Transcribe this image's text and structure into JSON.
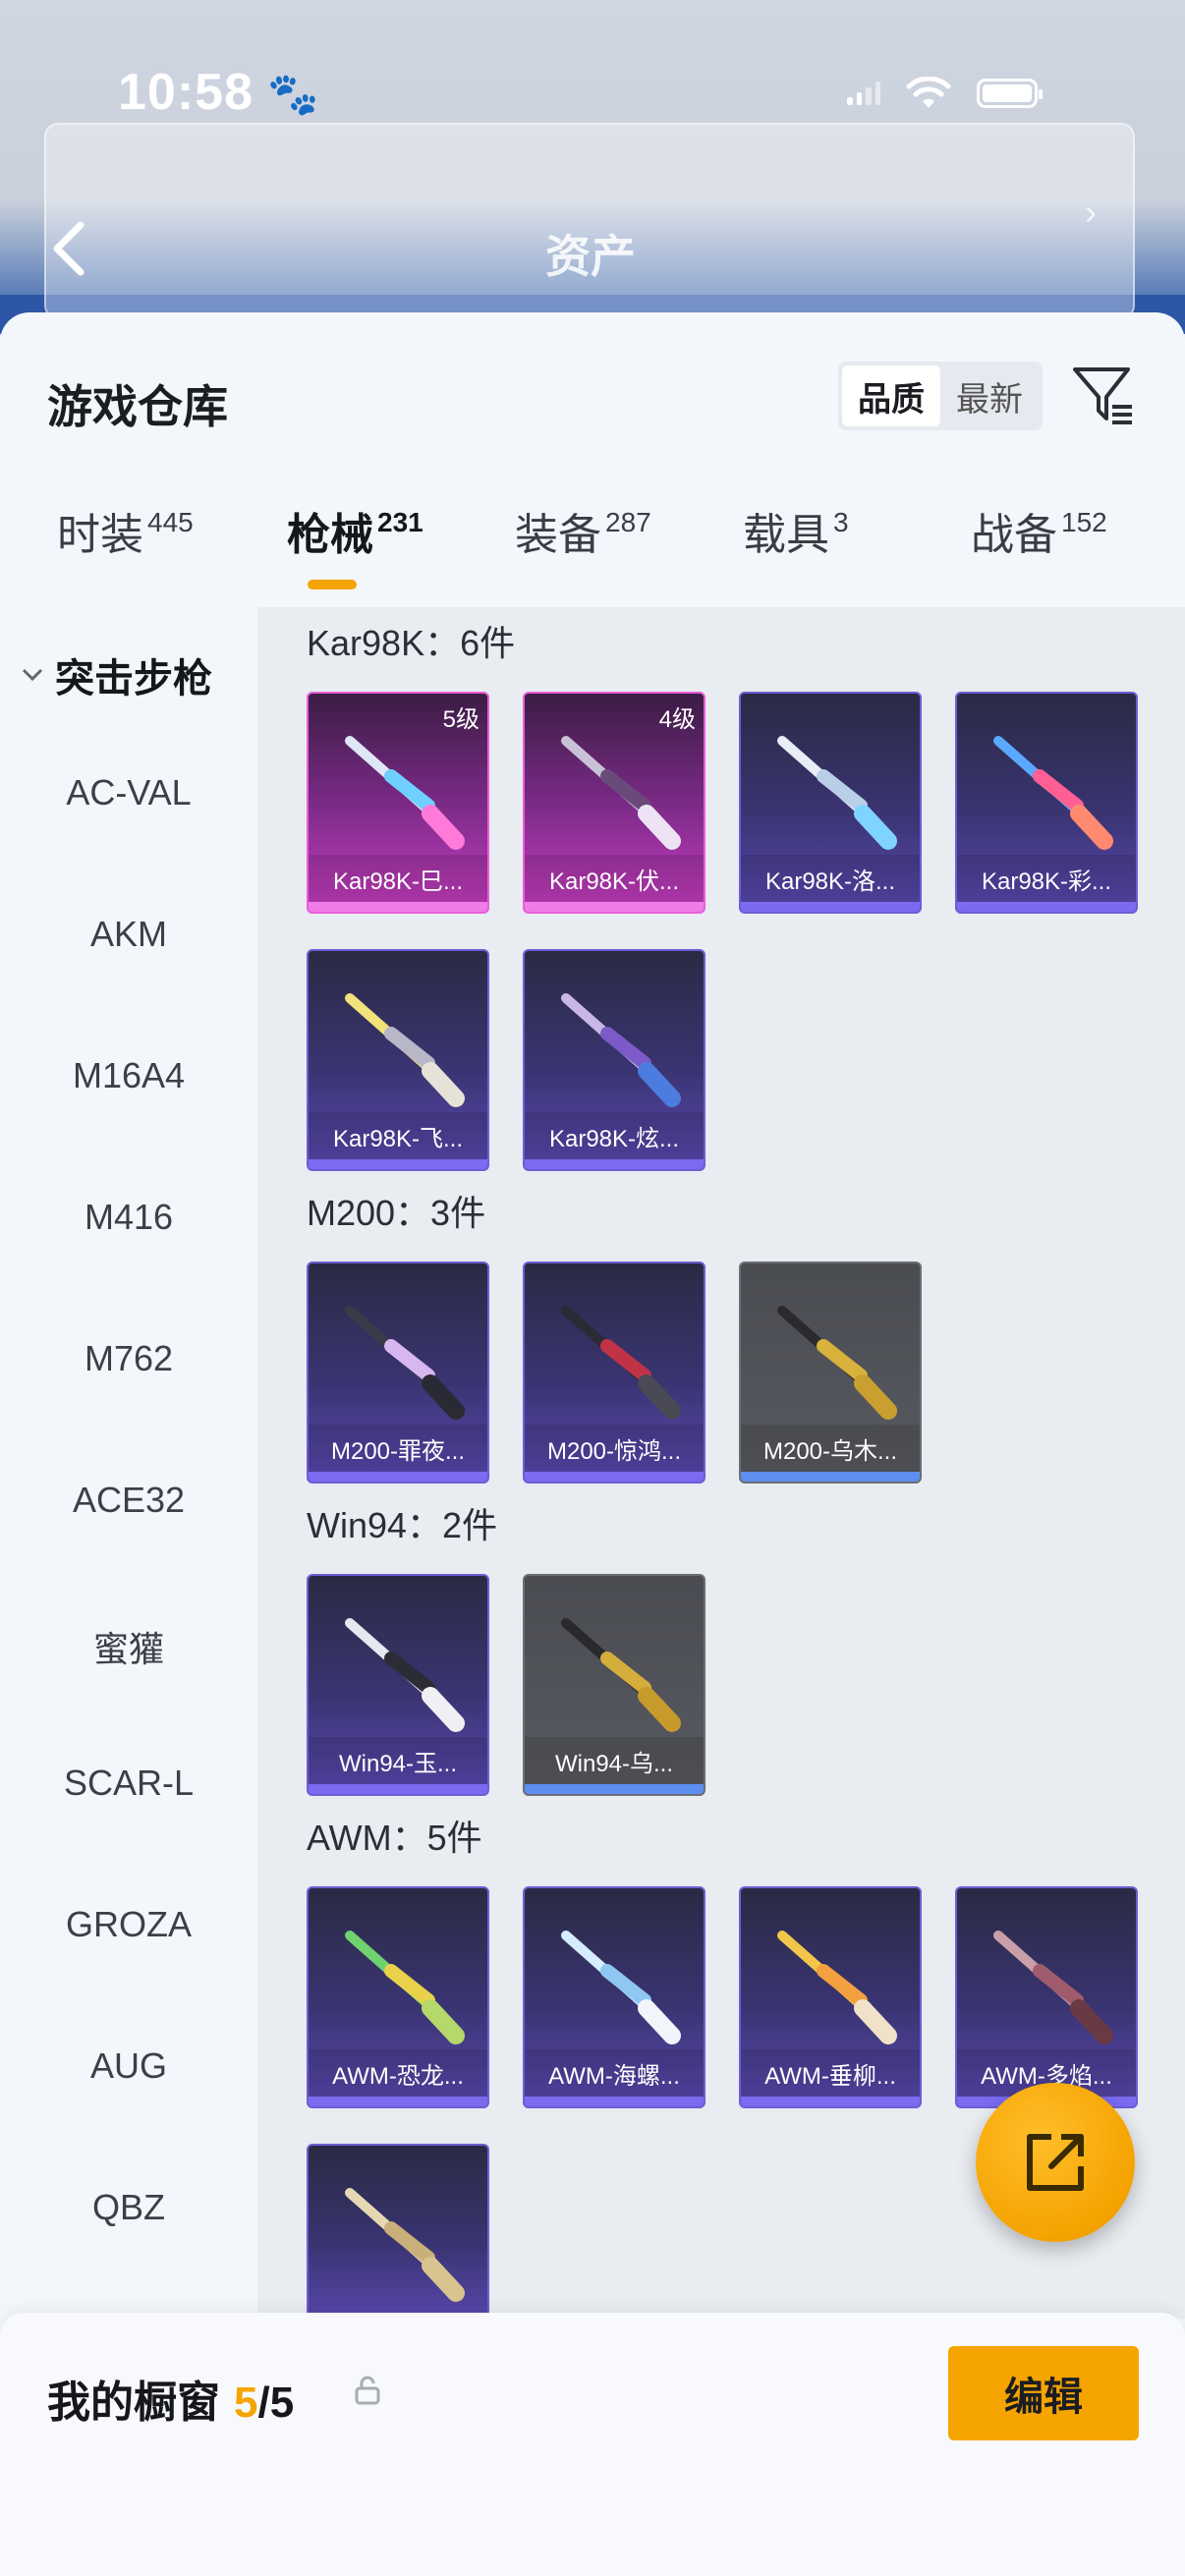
{
  "status_bar": {
    "time": "10:58"
  },
  "background_header": {
    "title": "资产"
  },
  "sheet": {
    "title": "游戏仓库",
    "sort": [
      "品质",
      "最新"
    ],
    "sort_active": "品质"
  },
  "tabs": [
    {
      "label": "时装",
      "count": "445"
    },
    {
      "label": "枪械",
      "count": "231"
    },
    {
      "label": "装备",
      "count": "287"
    },
    {
      "label": "载具",
      "count": "3"
    },
    {
      "label": "战备",
      "count": "152"
    }
  ],
  "sidebar": {
    "category": "突击步枪",
    "items": [
      "AC-VAL",
      "AKM",
      "M16A4",
      "M416",
      "M762",
      "ACE32",
      "蜜獾",
      "SCAR-L",
      "GROZA",
      "AUG",
      "QBZ"
    ]
  },
  "sections": [
    {
      "title": "Kar98K：6件",
      "items": [
        {
          "name": "Kar98K-巳...",
          "level": "5级"
        },
        {
          "name": "Kar98K-伏...",
          "level": "4级"
        },
        {
          "name": "Kar98K-洛...",
          "level": ""
        },
        {
          "name": "Kar98K-彩...",
          "level": ""
        },
        {
          "name": "Kar98K-飞...",
          "level": ""
        },
        {
          "name": "Kar98K-炫...",
          "level": ""
        }
      ]
    },
    {
      "title": "M200：3件",
      "items": [
        {
          "name": "M200-罪夜...",
          "level": ""
        },
        {
          "name": "M200-惊鸿...",
          "level": ""
        },
        {
          "name": "M200-乌木...",
          "level": ""
        }
      ]
    },
    {
      "title": "Win94：2件",
      "items": [
        {
          "name": "Win94-玉...",
          "level": ""
        },
        {
          "name": "Win94-乌...",
          "level": ""
        }
      ]
    },
    {
      "title": "AWM：5件",
      "items": [
        {
          "name": "AWM-恐龙...",
          "level": ""
        },
        {
          "name": "AWM-海螺...",
          "level": ""
        },
        {
          "name": "AWM-垂柳...",
          "level": ""
        },
        {
          "name": "AWM-多焰...",
          "level": ""
        },
        {
          "name": "",
          "level": ""
        }
      ]
    }
  ],
  "bottom_bar": {
    "label": "我的橱窗",
    "count": "5",
    "total": "/5",
    "edit_label": "编辑"
  },
  "icons": {
    "back": "chevron-left-icon",
    "filter": "filter-icon",
    "share": "share-icon",
    "lock": "lock-icon"
  },
  "colors": {
    "accent": "#f5a400",
    "rarity_gold": "#c93ec3",
    "rarity_purple": "#5b49b3",
    "rarity_grey": "#585a61"
  }
}
